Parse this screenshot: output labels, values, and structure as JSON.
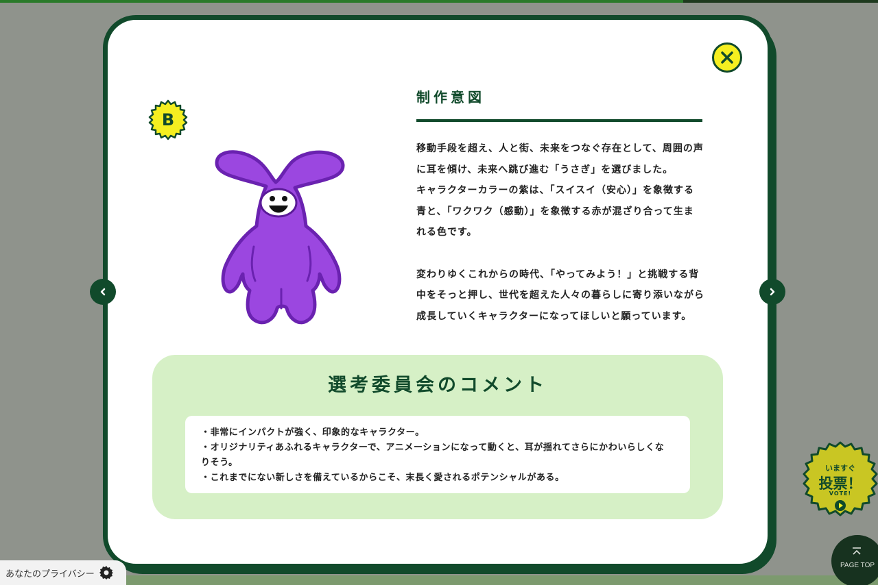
{
  "modal": {
    "badge": "B",
    "intent": {
      "title": "制作意図",
      "paragraph1": "移動手段を超え、人と街、未来をつなぐ存在として、周囲の声\nに耳を傾け、未来へ跳び進む「うさぎ」を選びました。\nキャラクターカラーの紫は、「スイスイ（安心）」を象徴する\n青と、「ワクワク（感動）」を象徴する赤が混ざり合って生ま\nれる色です。",
      "paragraph2": "変わりゆくこれからの時代、「やってみよう！」と挑戦する背\n中をそっと押し、世代を超えた人々の暮らしに寄り添いながら\n成長していくキャラクターになってほしいと願っています。"
    },
    "committee": {
      "title": "選考委員会のコメント",
      "comments": [
        "・非常にインパクトが強く、印象的なキャラクター。",
        "・オリジナリティあふれるキャラクターで、アニメーションになって動くと、耳が揺れてさらにかわいらしくな\nりそう。",
        "・これまでにない新しさを備えているからこそ、末長く愛されるポテンシャルがある。"
      ]
    },
    "icons": {
      "close": "close-icon",
      "prev": "chevron-left-icon",
      "next": "chevron-right-icon",
      "mascot": "purple-rabbit-mascot"
    }
  },
  "vote": {
    "small": "いますぐ",
    "big": "投票！",
    "en": "VOTE!"
  },
  "page_top": {
    "label": "PAGE TOP"
  },
  "privacy": {
    "label": "あなたのプライバシー"
  },
  "colors": {
    "dark_green": "#114a2b",
    "yellow": "#f5ef20",
    "light_green": "#d6f0c6",
    "purple": "#9b47e0"
  }
}
